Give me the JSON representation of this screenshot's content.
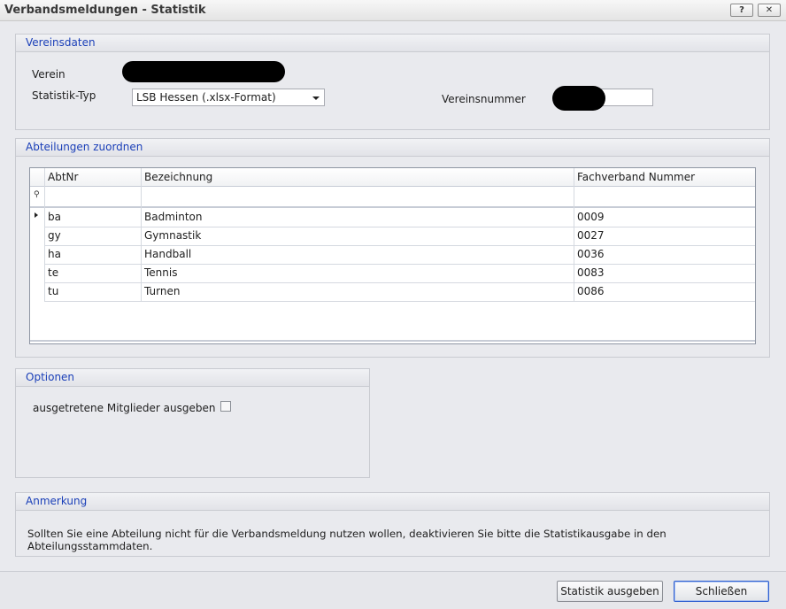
{
  "window": {
    "title": "Verbandsmeldungen - Statistik",
    "help_label": "?",
    "close_label": "✕"
  },
  "vereinsdaten": {
    "header": "Vereinsdaten",
    "verein_label": "Verein",
    "statistik_typ_label": "Statistik-Typ",
    "statistik_typ_value": "LSB Hessen (.xlsx-Format)",
    "vereinsnummer_label": "Vereinsnummer"
  },
  "abteilungen": {
    "header": "Abteilungen zuordnen",
    "columns": [
      "AbtNr",
      "Bezeichnung",
      "Fachverband Nummer"
    ],
    "rows": [
      {
        "abtnr": "ba",
        "bezeichnung": "Badminton",
        "fachverband": "0009"
      },
      {
        "abtnr": "gy",
        "bezeichnung": "Gymnastik",
        "fachverband": "0027"
      },
      {
        "abtnr": "ha",
        "bezeichnung": "Handball",
        "fachverband": "0036"
      },
      {
        "abtnr": "te",
        "bezeichnung": "Tennis",
        "fachverband": "0083"
      },
      {
        "abtnr": "tu",
        "bezeichnung": "Turnen",
        "fachverband": "0086"
      }
    ]
  },
  "optionen": {
    "header": "Optionen",
    "ausgetretene_label": "ausgetretene Mitglieder ausgeben",
    "ausgetretene_checked": false
  },
  "anmerkung": {
    "header": "Anmerkung",
    "text": "Sollten Sie eine Abteilung nicht für die Verbandsmeldung nutzen wollen, deaktivieren Sie bitte die Statistikausgabe in den Abteilungsstammdaten."
  },
  "footer": {
    "statistik_button": "Statistik ausgeben",
    "close_button": "Schließen"
  }
}
